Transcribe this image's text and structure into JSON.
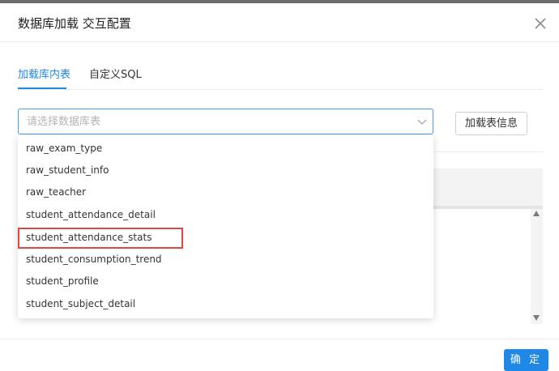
{
  "dialog": {
    "title": "数据库加载 交互配置",
    "close_icon": "close-icon"
  },
  "tabs": [
    {
      "label": "加载库内表",
      "active": true
    },
    {
      "label": "自定义SQL",
      "active": false
    }
  ],
  "table_select": {
    "value": "",
    "placeholder": "请选择数据库表",
    "arrow_icon": "chevron-down-icon"
  },
  "load_info_button": {
    "label": "加载表信息"
  },
  "dropdown": {
    "options": [
      "raw_exam_type",
      "raw_student_info",
      "raw_teacher",
      "student_attendance_detail",
      "student_attendance_stats",
      "student_consumption_trend",
      "student_profile",
      "student_subject_detail"
    ],
    "highlighted_option": "student_attendance_stats"
  },
  "footer": {
    "confirm_label": "确 定"
  },
  "colors": {
    "accent": "#1f87e5",
    "highlight_border": "#e04848",
    "select_border": "#4a9ff0"
  }
}
